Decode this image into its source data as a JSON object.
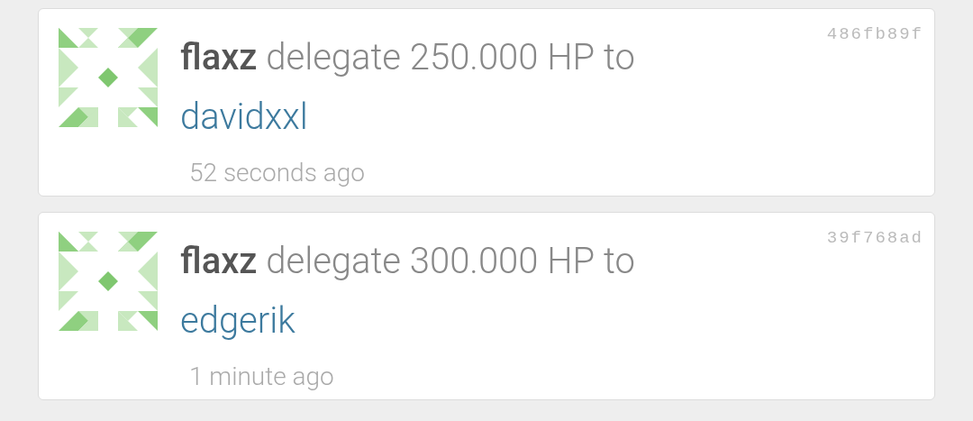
{
  "activities": [
    {
      "author": "flaxz",
      "action": "delegate 250.000 HP to",
      "target": "davidxxl",
      "time": "52 seconds ago",
      "hash": "486fb89f"
    },
    {
      "author": "flaxz",
      "action": "delegate 300.000 HP to",
      "target": "edgerik",
      "time": "1 minute ago",
      "hash": "39f768ad"
    }
  ]
}
